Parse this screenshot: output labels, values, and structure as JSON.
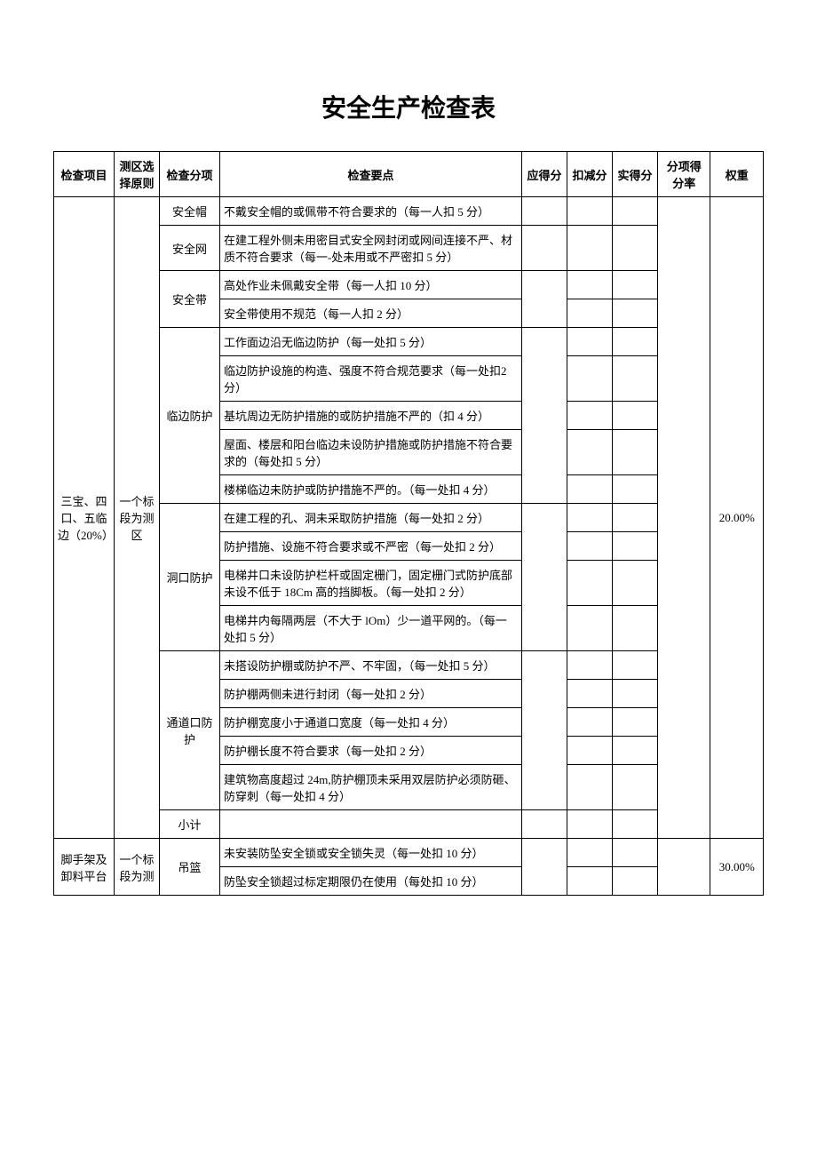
{
  "title": "安全生产检查表",
  "headers": {
    "col1": "检查项目",
    "col2": "测区选择原则",
    "col3": "检查分项",
    "col4": "检查要点",
    "col5": "应得分",
    "col6": "扣减分",
    "col7": "实得分",
    "col8": "分项得分率",
    "col9": "权重"
  },
  "section1": {
    "item": "三宝、四口、五临边（20%）",
    "zone": "一个标段为测区",
    "weight": "20.00%",
    "sub1": {
      "name": "安全帽",
      "p1": "不戴安全帽的或佩带不符合要求的（每一人扣 5 分）"
    },
    "sub2": {
      "name": "安全网",
      "p1": "在建工程外侧未用密目式安全网封闭或网间连接不严、材质不符合要求（每一-处未用或不严密扣 5 分）"
    },
    "sub3": {
      "name": "安全带",
      "p1": "高处作业未佩戴安全带（每一人扣 10 分）",
      "p2": "安全带使用不规范（每一人扣 2 分）"
    },
    "sub4": {
      "name": "临边防护",
      "p1": "工作面边沿无临边防护（每一处扣 5 分）",
      "p2": "临边防护设施的构造、强度不符合规范要求（每一处扣2 分）",
      "p3": "基坑周边无防护措施的或防护措施不严的（扣 4 分）",
      "p4": "屋面、楼层和阳台临边未设防护措施或防护措施不符合要求的（每处扣 5 分）",
      "p5": "楼梯临边未防护或防护措施不严的。（每一处扣 4 分）"
    },
    "sub5": {
      "name": "洞口防护",
      "p1": "在建工程的孔、洞未采取防护措施（每一处扣 2 分）",
      "p2": "防护措施、设施不符合要求或不严密（每一处扣 2 分）",
      "p3": "电梯井口未设防护栏杆或固定栅门，固定栅门式防护底部未设不低于 18Cm 高的挡脚板。（每一处扣 2 分）",
      "p4": "电梯井内每隔两层（不大于 lOm）少一道平网的。（每一处扣 5 分）"
    },
    "sub6": {
      "name": "通道口防护",
      "p1": "未搭设防护棚或防护不严、不牢固，（每一处扣 5 分）",
      "p2": "防护棚两侧未进行封闭（每一处扣 2 分）",
      "p3": "防护棚宽度小于通道口宽度（每一处扣 4 分）",
      "p4": "防护棚长度不符合要求（每一处扣 2 分）",
      "p5": "建筑物高度超过 24m,防护棚顶未采用双层防护必须防砸、防穿刺（每一处扣 4 分）"
    },
    "subtotal": "小计"
  },
  "section2": {
    "item": "脚手架及卸料平台",
    "zone": "一个标段为测",
    "weight": "30.00%",
    "sub1": {
      "name": "吊篮",
      "p1": "未安装防坠安全锁或安全锁失灵（每一处扣 10 分）",
      "p2": "防坠安全锁超过标定期限仍在使用（每处扣 10 分）"
    }
  }
}
